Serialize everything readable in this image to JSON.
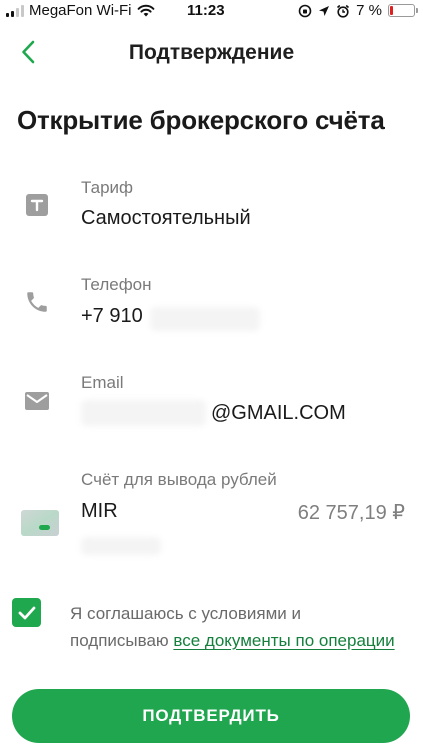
{
  "status_bar": {
    "carrier": "MegaFon Wi-Fi",
    "time": "11:23",
    "battery": "7 %",
    "battery_level": 0.07
  },
  "header": {
    "title": "Подтверждение"
  },
  "page_title": "Открытие брокерского счёта",
  "rows": {
    "tariff": {
      "label": "Тариф",
      "value": "Самостоятельный"
    },
    "phone": {
      "label": "Телефон",
      "value": "+7 910"
    },
    "email": {
      "label": "Email",
      "value": "@GMAIL.COM"
    },
    "account": {
      "label": "Счёт для вывода рублей",
      "value": "MIR",
      "amount": "62 757,19 ₽"
    }
  },
  "agreement": {
    "text": "Я соглашаюсь с условиями и подписываю ",
    "link": "все документы по операции",
    "checked": true
  },
  "confirm_button": "ПОДТВЕРДИТЬ",
  "colors": {
    "accent": "#21a650",
    "link": "#15803d"
  }
}
